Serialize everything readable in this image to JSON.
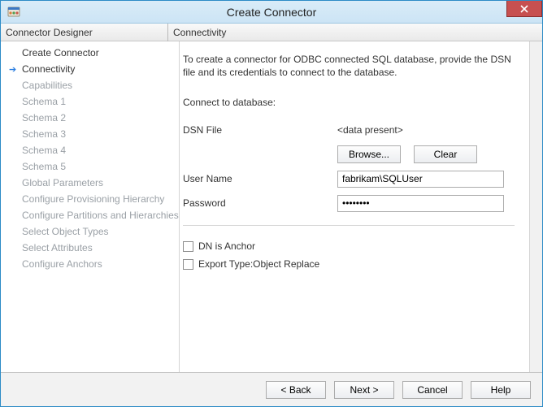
{
  "window": {
    "title": "Create Connector"
  },
  "leftHeader": "Connector Designer",
  "nav": {
    "items": [
      {
        "label": "Create Connector",
        "state": "visited"
      },
      {
        "label": "Connectivity",
        "state": "current"
      },
      {
        "label": "Capabilities",
        "state": "disabled"
      },
      {
        "label": "Schema 1",
        "state": "disabled"
      },
      {
        "label": "Schema 2",
        "state": "disabled"
      },
      {
        "label": "Schema 3",
        "state": "disabled"
      },
      {
        "label": "Schema 4",
        "state": "disabled"
      },
      {
        "label": "Schema 5",
        "state": "disabled"
      },
      {
        "label": "Global Parameters",
        "state": "disabled"
      },
      {
        "label": "Configure Provisioning Hierarchy",
        "state": "disabled"
      },
      {
        "label": "Configure Partitions and Hierarchies",
        "state": "disabled"
      },
      {
        "label": "Select Object Types",
        "state": "disabled"
      },
      {
        "label": "Select Attributes",
        "state": "disabled"
      },
      {
        "label": "Configure Anchors",
        "state": "disabled"
      }
    ]
  },
  "rightHeader": "Connectivity",
  "content": {
    "intro": "To create a connector for ODBC connected SQL database, provide the DSN file and its credentials to connect to the database.",
    "connectHeading": "Connect to database:",
    "dsnLabel": "DSN File",
    "dsnValue": "<data present>",
    "browseLabel": "Browse...",
    "clearLabel": "Clear",
    "userLabel": "User Name",
    "userValue": "fabrikam\\SQLUser",
    "passLabel": "Password",
    "passValue": "••••••••",
    "chkDnAnchor": "DN is Anchor",
    "chkExport": "Export Type:Object Replace"
  },
  "footer": {
    "back": "<  Back",
    "next": "Next  >",
    "cancel": "Cancel",
    "help": "Help"
  }
}
